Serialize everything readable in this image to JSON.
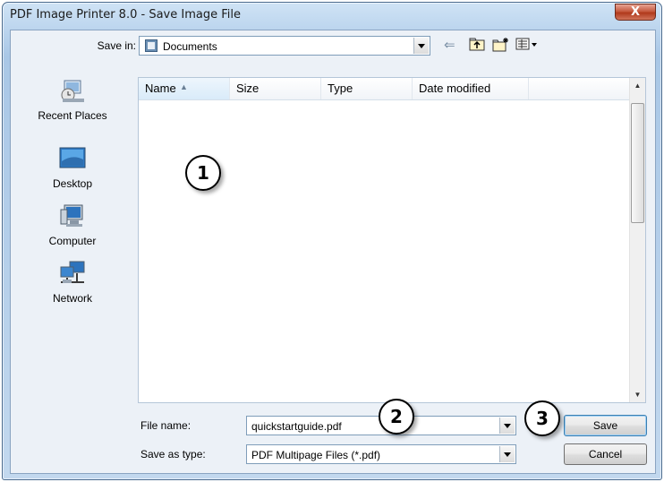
{
  "window": {
    "title": "PDF Image Printer 8.0 - Save Image File",
    "close_label": "X"
  },
  "save_in": {
    "label": "Save in:",
    "value": "Documents"
  },
  "toolbar": {
    "back_glyph": "⇐",
    "up_glyph": "⮤",
    "newfolder_glyph": "✳",
    "views_glyph": "▦▾"
  },
  "places": [
    {
      "label": "Recent Places",
      "icon": "recent-places-icon"
    },
    {
      "label": "Desktop",
      "icon": "desktop-icon"
    },
    {
      "label": "Computer",
      "icon": "computer-icon"
    },
    {
      "label": "Network",
      "icon": "network-icon"
    }
  ],
  "list": {
    "columns": [
      "Name",
      "Size",
      "Type",
      "Date modified"
    ],
    "sorted_column": "Name",
    "rows": []
  },
  "file_name": {
    "label": "File name:",
    "value": "quickstartguide.pdf"
  },
  "save_as_type": {
    "label": "Save as type:",
    "value": "PDF Multipage Files (*.pdf)"
  },
  "buttons": {
    "save": "Save",
    "cancel": "Cancel"
  },
  "callouts": [
    "1",
    "2",
    "3"
  ],
  "colors": {
    "frame": "#bcd5ee",
    "close": "#c65a3f",
    "list_bg": "#ffffff"
  }
}
